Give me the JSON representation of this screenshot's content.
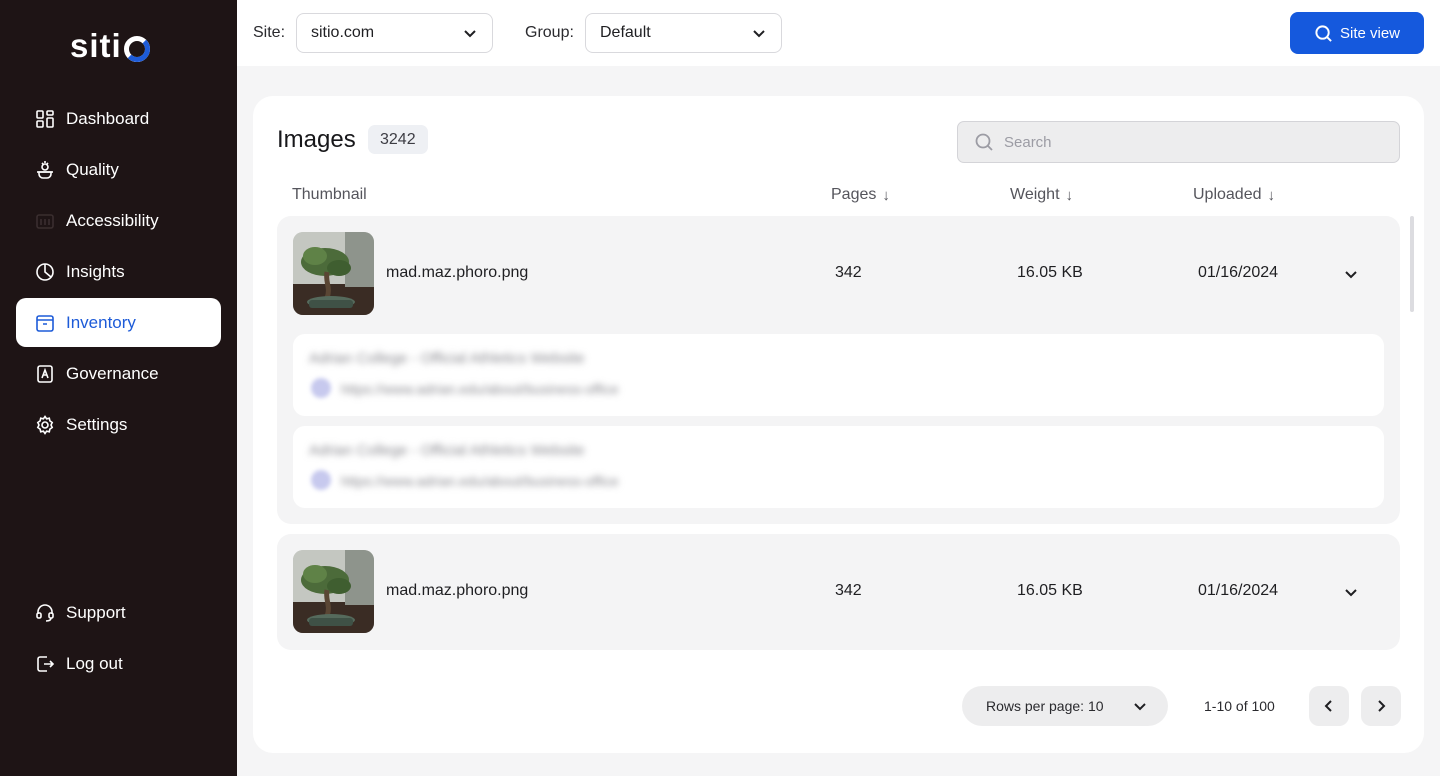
{
  "brand": {
    "logo_text": "siti",
    "accent": "#1d5bd8"
  },
  "sidebar": {
    "items": [
      {
        "label": "Dashboard",
        "icon": "grid-icon"
      },
      {
        "label": "Quality",
        "icon": "quality-icon"
      },
      {
        "label": "Accessibility",
        "icon": "accessibility-icon"
      },
      {
        "label": "Insights",
        "icon": "pie-chart-icon"
      },
      {
        "label": "Inventory",
        "icon": "inventory-icon",
        "active": true
      },
      {
        "label": "Governance",
        "icon": "governance-icon"
      },
      {
        "label": "Settings",
        "icon": "gear-icon"
      }
    ],
    "bottom_items": [
      {
        "label": "Support",
        "icon": "headset-icon"
      },
      {
        "label": "Log out",
        "icon": "logout-icon"
      }
    ]
  },
  "topbar": {
    "site_label": "Site:",
    "site_value": "sitio.com",
    "group_label": "Group:",
    "group_value": "Default",
    "site_view_label": "Site view"
  },
  "images": {
    "title": "Images",
    "count": "3242",
    "search_placeholder": "Search",
    "columns": {
      "thumbnail": "Thumbnail",
      "pages": "Pages",
      "weight": "Weight",
      "uploaded": "Uploaded",
      "sort_arrow": "↓"
    },
    "rows": [
      {
        "filename": "mad.maz.phoro.png",
        "pages": "342",
        "weight": "16.05 KB",
        "uploaded": "01/16/2024",
        "expanded": true,
        "sub_items": [
          {
            "title": "Adrian College - Official Athletics Website",
            "url": "https://www.adrian.edu/about/business-office"
          },
          {
            "title": "Adrian College - Official Athletics Website",
            "url": "https://www.adrian.edu/about/business-office"
          }
        ]
      },
      {
        "filename": "mad.maz.phoro.png",
        "pages": "342",
        "weight": "16.05 KB",
        "uploaded": "01/16/2024",
        "expanded": false
      }
    ]
  },
  "pagination": {
    "rows_per_page": "Rows per page: 10",
    "range": "1-10 of 100"
  }
}
